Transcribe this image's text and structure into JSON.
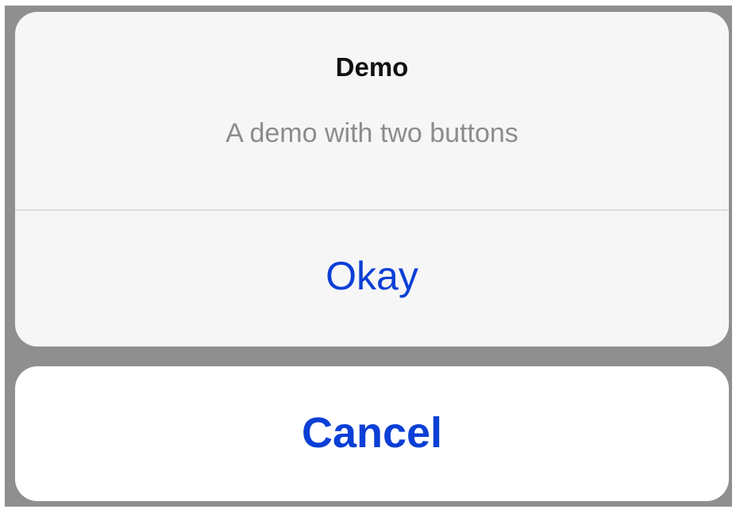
{
  "dialog": {
    "title": "Demo",
    "message": "A demo with two buttons",
    "okay_label": "Okay",
    "cancel_label": "Cancel"
  },
  "colors": {
    "backdrop": "#8f8f8f",
    "sheet_background": "#f6f6f6",
    "cancel_background": "#ffffff",
    "accent": "#0b3fd6",
    "title_text": "#111111",
    "message_text": "#8c8c8c",
    "divider": "#dcdcdc"
  }
}
